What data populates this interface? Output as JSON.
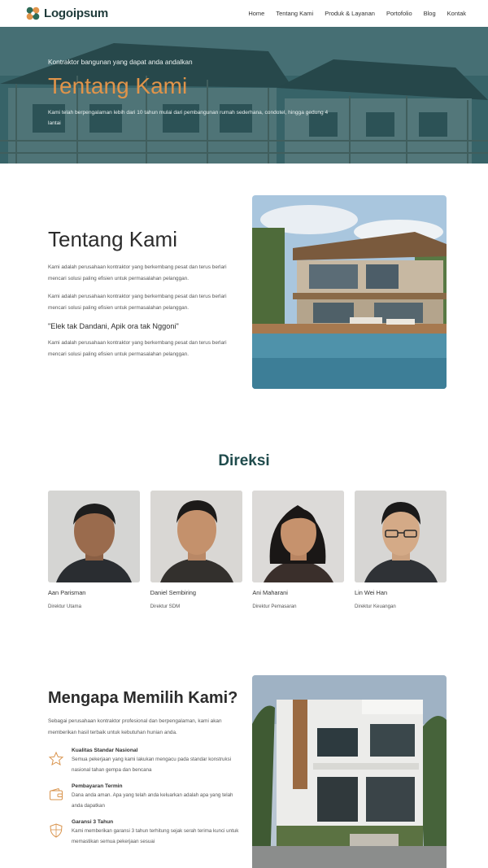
{
  "brand": {
    "name": "Logoipsum",
    "accent": "#e0944a",
    "primary": "#1f4b4c"
  },
  "nav": {
    "items": [
      {
        "label": "Home"
      },
      {
        "label": "Tentang Kami"
      },
      {
        "label": "Produk & Layanan"
      },
      {
        "label": "Portofolio"
      },
      {
        "label": "Blog"
      },
      {
        "label": "Kontak"
      }
    ]
  },
  "hero": {
    "tagline": "Kontraktor bangunan yang dapat anda andalkan",
    "title": "Tentang Kami",
    "description": "Kami telah berpengalaman lebih dari 10 tahun mulai dari pembangunan rumah sederhana, condotel, hingga gedung 4 lantai"
  },
  "about": {
    "title": "Tentang Kami",
    "p1": "Kami adalah perusahaan kontraktor yang berkembang pesat dan terus berlari mencari solusi paling efisien untuk permasalahan pelanggan.",
    "p2": "Kami adalah perusahaan kontraktor yang berkembang pesat dan terus berlari mencari solusi paling efisien untuk permasalahan pelanggan.",
    "quote": "\"Elek tak Dandani, Apik ora tak Nggoni\"",
    "p3": "Kami adalah perusahaan kontraktor yang berkembang pesat dan terus berlari mencari solusi paling efisien untuk permasalahan pelanggan."
  },
  "direksi": {
    "title": "Direksi",
    "members": [
      {
        "name": "Aan Parisman",
        "role": "Direktur Utama"
      },
      {
        "name": "Daniel Sembiring",
        "role": "Direktur SDM"
      },
      {
        "name": "Ani Maharani",
        "role": "Direktur Pemasaran"
      },
      {
        "name": "Lin Wei Han",
        "role": "Direktur Keuangan"
      }
    ]
  },
  "why": {
    "title": "Mengapa Memilih Kami?",
    "intro": "Sebagai perusahaan kontraktor profesional dan berpengalaman, kami akan memberikan hasil terbaik untuk kebutuhan hunian anda.",
    "features": [
      {
        "icon": "star-icon",
        "title": "Kualitas Standar Nasional",
        "desc": "Semua pekerjaan yang kami lakukan mengacu pada standar konstruksi nasional tahan gempa dan bencana"
      },
      {
        "icon": "wallet-icon",
        "title": "Pembayaran Termin",
        "desc": "Dana anda aman. Apa yang telah anda keluarkan adalah apa yang telah anda dapatkan"
      },
      {
        "icon": "shield-icon",
        "title": "Garansi 3 Tahun",
        "desc": "Kami memberikan garansi 3 tahun terhitung sejak serah terima kunci untuk memastikan semua pekerjaan sesuai"
      }
    ]
  }
}
